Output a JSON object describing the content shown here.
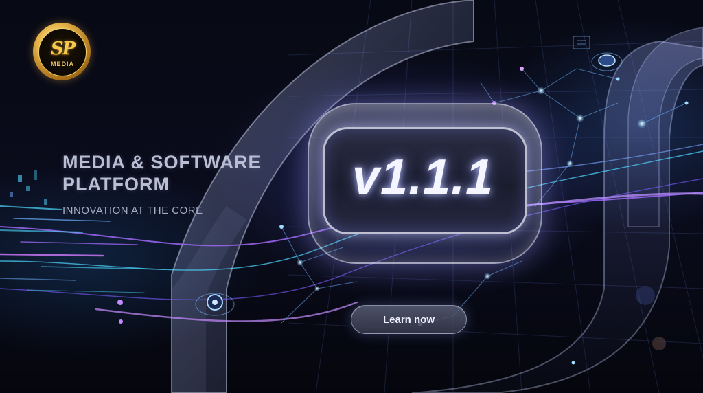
{
  "brand": {
    "monogram": "SP",
    "name": "MEDIA"
  },
  "hero": {
    "title_line1": "MEDIA & SOFTWARE",
    "title_line2": "PLATFORM",
    "tagline": "INNOVATION AT THE CORE"
  },
  "version": {
    "label": "v1.1.1"
  },
  "cta": {
    "label": "Learn now"
  },
  "colors": {
    "background": "#05060d",
    "accent_cyan": "#4fd8ff",
    "accent_purple": "#a66bff",
    "logo_gold": "#e6b54a"
  },
  "icons": [
    "tech-network-lines",
    "data-node",
    "lens-gadget"
  ]
}
